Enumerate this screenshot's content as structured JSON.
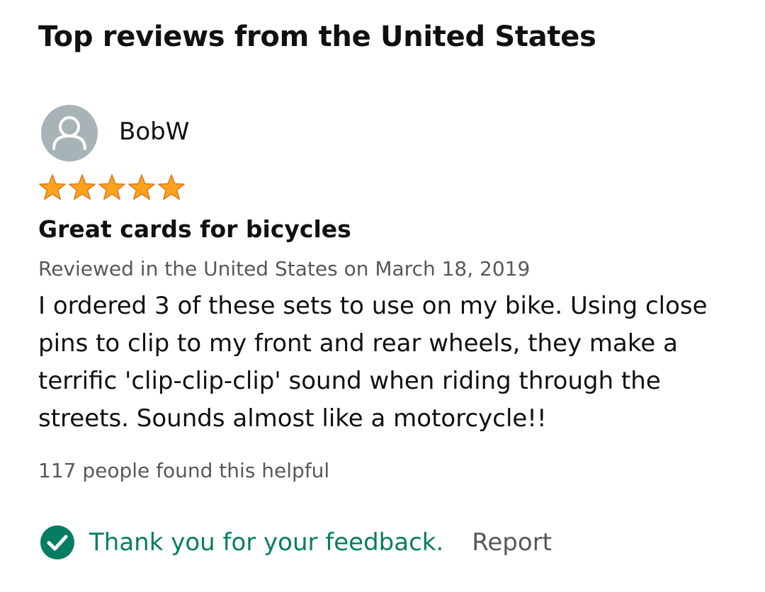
{
  "section": {
    "title": "Top reviews from the United States"
  },
  "review": {
    "reviewer": {
      "name": "BobW",
      "avatar_icon": "user-silhouette-icon",
      "avatar_color": "#a7b3b7"
    },
    "rating": {
      "stars": 5,
      "max": 5,
      "star_color": "#ffa41c"
    },
    "title": "Great cards for bicycles",
    "meta": "Reviewed in the United States on March 18, 2019",
    "body": "I ordered 3 of these sets to use on my bike. Using close pins to clip to my front and rear wheels, they make a terrific 'clip-clip-clip' sound when riding through the streets. Sounds almost like a motorcycle!!",
    "helpful_count": "117 people found this helpful"
  },
  "feedback": {
    "icon": "check-circle-icon",
    "thanks_text": "Thank you for your feedback.",
    "thanks_color": "#067d62",
    "report_label": "Report"
  }
}
